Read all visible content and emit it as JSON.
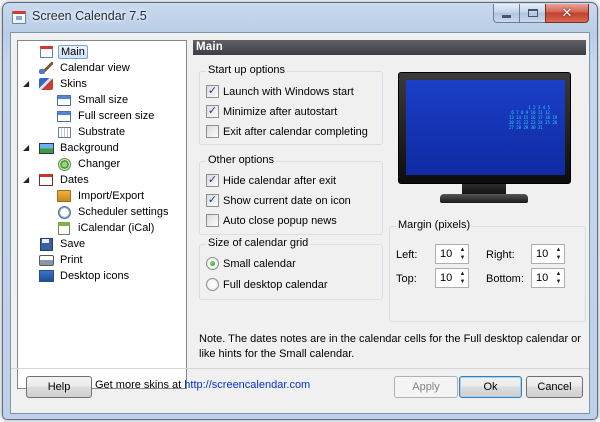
{
  "window": {
    "title": "Screen Calendar 7.5"
  },
  "tree": {
    "items": [
      {
        "label": "Main",
        "icon": "main-calendar-icon"
      },
      {
        "label": "Calendar view",
        "icon": "brush-icon"
      },
      {
        "label": "Skins",
        "icon": "skins-icon"
      },
      {
        "label": "Small size",
        "icon": "small-window-icon"
      },
      {
        "label": "Full screen size",
        "icon": "full-window-icon"
      },
      {
        "label": "Substrate",
        "icon": "grid-icon"
      },
      {
        "label": "Background",
        "icon": "background-icon"
      },
      {
        "label": "Changer",
        "icon": "changer-icon"
      },
      {
        "label": "Dates",
        "icon": "dates-icon"
      },
      {
        "label": "Import/Export",
        "icon": "import-export-icon"
      },
      {
        "label": "Scheduler settings",
        "icon": "scheduler-icon"
      },
      {
        "label": "iCalendar (iCal)",
        "icon": "icalendar-icon"
      },
      {
        "label": "Save",
        "icon": "save-icon"
      },
      {
        "label": "Print",
        "icon": "print-icon"
      },
      {
        "label": "Desktop icons",
        "icon": "desktop-icons-icon"
      }
    ]
  },
  "panel": {
    "title": "Main"
  },
  "startup": {
    "title": "Start up options",
    "options": [
      {
        "label": "Launch with Windows start",
        "checked": true
      },
      {
        "label": "Minimize after autostart",
        "checked": true
      },
      {
        "label": "Exit after calendar completing",
        "checked": false
      }
    ]
  },
  "other": {
    "title": "Other options",
    "options": [
      {
        "label": "Hide calendar after exit",
        "checked": true
      },
      {
        "label": "Show current date on icon",
        "checked": true
      },
      {
        "label": "Auto close popup news",
        "checked": false
      }
    ]
  },
  "grid": {
    "title": "Size of calendar grid",
    "options": [
      {
        "label": "Small calendar",
        "selected": true
      },
      {
        "label": "Full desktop calendar",
        "selected": false
      }
    ]
  },
  "margin": {
    "title": "Margin (pixels)",
    "left_label": "Left:",
    "left_value": "10",
    "right_label": "Right:",
    "right_value": "10",
    "top_label": "Top:",
    "top_value": "10",
    "bottom_label": "Bottom:",
    "bottom_value": "10"
  },
  "note": "Note. The dates notes are in the calendar cells for the Full desktop calendar or like hints for the Small calendar.",
  "footer": {
    "help": "Help",
    "get_more": "Get more skins at",
    "link": "http://screencalendar.com",
    "apply": "Apply",
    "ok": "Ok",
    "cancel": "Cancel"
  },
  "colors": {
    "accent": "#0033cc",
    "monitor_screen": "#1b3fc8",
    "check_mark": "#21348a"
  }
}
